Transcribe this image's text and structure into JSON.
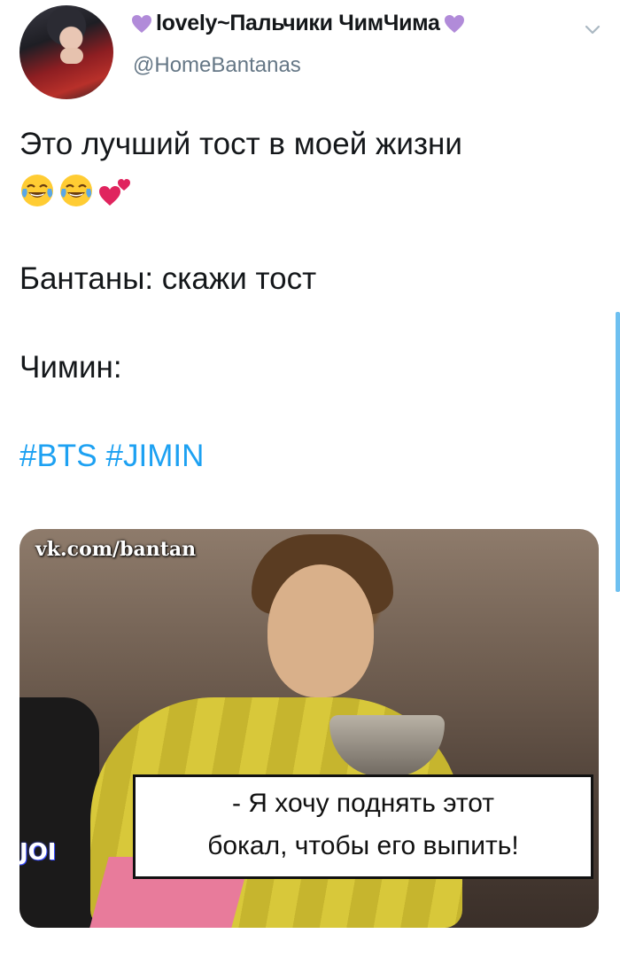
{
  "header": {
    "display_name": "lovely~Пальчики ЧимЧима",
    "handle": "@HomeBantanas",
    "name_heart_icon": "purple-heart-icon",
    "menu_icon": "chevron-down-icon"
  },
  "tweet": {
    "line1": "Это лучший тост в моей жизни",
    "emojis": [
      "face-with-tears-of-joy-icon",
      "face-with-tears-of-joy-icon",
      "two-hearts-icon"
    ],
    "line2": "Бантаны: скажи тост",
    "line3": "Чимин:",
    "hashtags": [
      "#BTS",
      "#JIMIN"
    ]
  },
  "media": {
    "watermark": "vk.com/bantan",
    "caption_line1": "- Я хочу поднять этот",
    "caption_line2": "бокал, чтобы его выпить!",
    "side_text": "JOI"
  },
  "colors": {
    "link": "#1da1f2",
    "handle": "#657786",
    "heart": "#b18bd9"
  }
}
